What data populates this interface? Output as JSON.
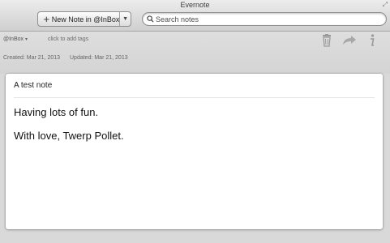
{
  "window": {
    "title": "Evernote"
  },
  "toolbar": {
    "new_note_label": "New Note in @InBox",
    "search_placeholder": "Search notes"
  },
  "meta": {
    "notebook": "@InBox",
    "tags_placeholder": "click to add tags",
    "created": "Created: Mar 21, 2013",
    "updated": "Updated: Mar 21, 2013"
  },
  "note": {
    "title": "A test note",
    "body": [
      "Having lots of fun.",
      "With love, Twerp Pollet."
    ]
  },
  "icons": {
    "new_note": "plus-icon",
    "search": "search-icon",
    "delete": "trash-icon",
    "share": "share-arrow-icon",
    "info": "info-icon",
    "resize": "resize-icon"
  }
}
